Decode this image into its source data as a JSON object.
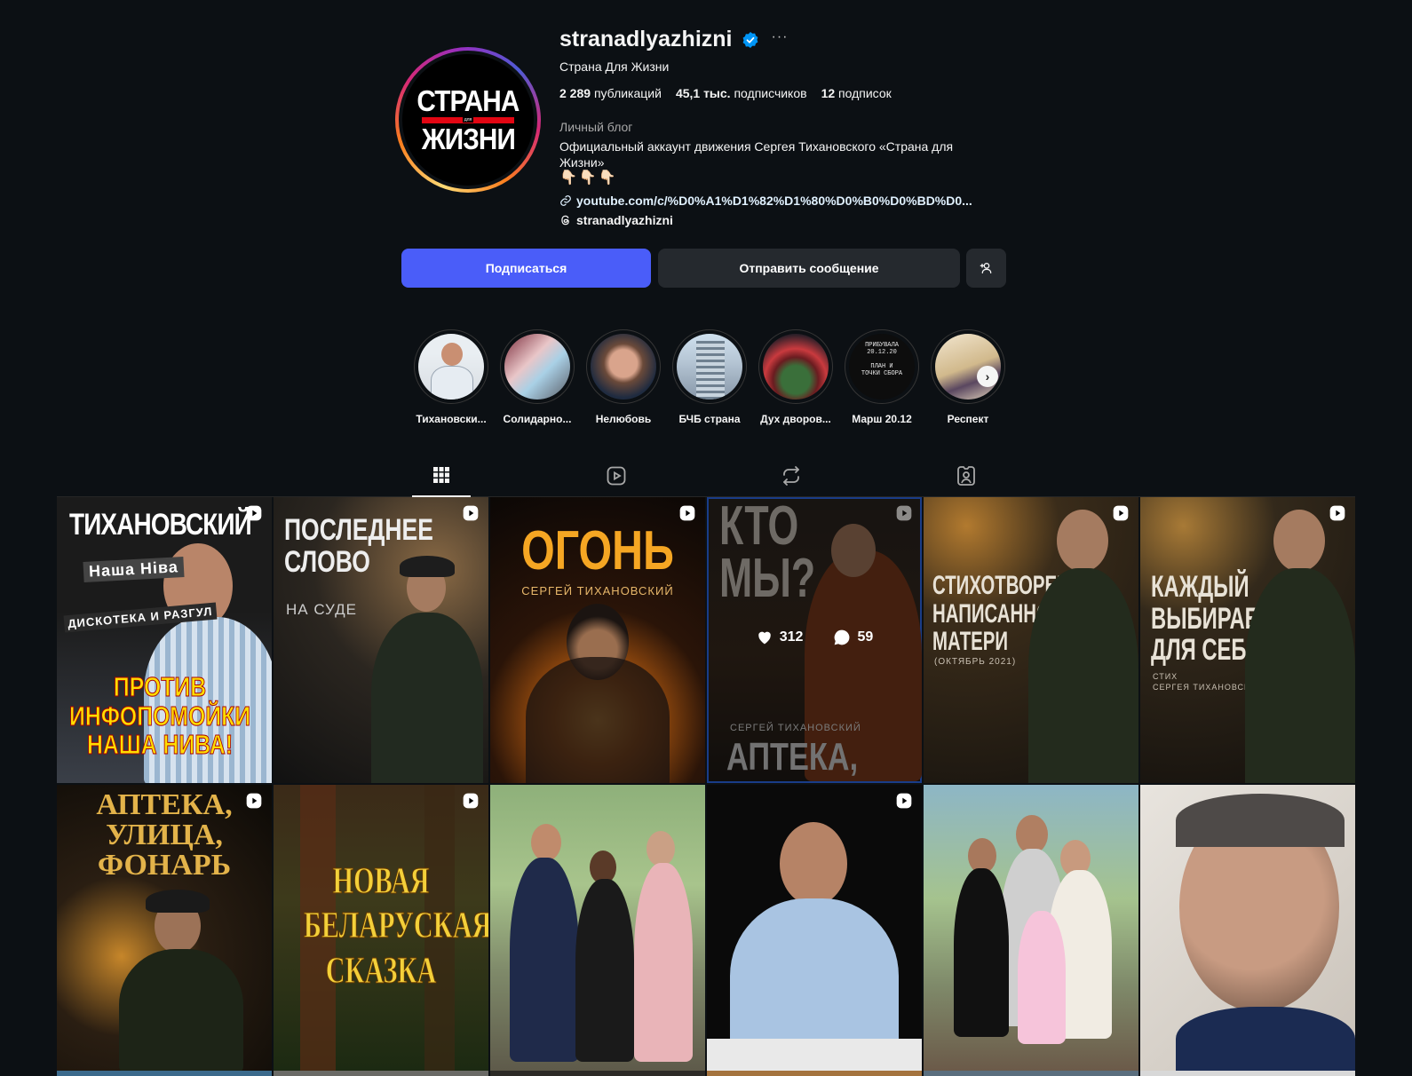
{
  "profile": {
    "username": "stranadlyazhizni",
    "full_name": "Страна Для Жизни",
    "avatar_text": {
      "line1": "СТРАНА",
      "line2": "для",
      "line3": "ЖИЗНИ"
    },
    "stats": {
      "posts_count": "2 289",
      "posts_label": "публикаций",
      "followers_count": "45,1 тыс.",
      "followers_label": "подписчиков",
      "following_count": "12",
      "following_label": "подписок"
    },
    "category": "Личный блог",
    "bio": "Официальный аккаунт движения Сергея Тихановского «Страна для Жизни»",
    "bio_emojis": "👇🏻👇🏻👇🏻",
    "link": "youtube.com/c/%D0%A1%D1%82%D1%80%D0%B0%D0%BD%D0...",
    "threads_handle": "stranadlyazhizni",
    "more_label": "···"
  },
  "actions": {
    "follow_label": "Подписаться",
    "message_label": "Отправить сообщение"
  },
  "highlights": [
    {
      "label": "Тихановски..."
    },
    {
      "label": "Солидарно..."
    },
    {
      "label": "Нелюбовь"
    },
    {
      "label": "БЧБ страна"
    },
    {
      "label": "Дух дворов..."
    },
    {
      "label": "Марш 20.12",
      "cover_text": "ПРИБУВАЛА\n20.12.20\n\nПЛАН И\nТОЧКИ СБОРА"
    },
    {
      "label": "Респект"
    }
  ],
  "posts": [
    {
      "title": "ТИХАНОВСКИЙ",
      "title2": "ПРОТИВ\nИНФОПОМОЙКИ\nНАША НИВА!",
      "sub": "Наша Ніва",
      "sub2": "ДИСКОТЕКА И РАЗГУЛ",
      "reel": true
    },
    {
      "title": "ПОСЛЕДНЕЕ\nСЛОВО",
      "sub": "НА СУДЕ",
      "reel": true
    },
    {
      "title": "ОГОНЬ",
      "sub": "СЕРГЕЙ ТИХАНОВСКИЙ",
      "reel": true
    },
    {
      "title": "КТО\nМЫ?",
      "sub": "СЕРГЕЙ ТИХАНОВСКИЙ",
      "title2": "АПТЕКА,",
      "reel": true,
      "likes": "312",
      "comments": "59"
    },
    {
      "title": "СТИХОТВОРЕНИЕ,\nНАПИСАННОЕ\nМАТЕРИ",
      "sub": "(ОКТЯБРЬ 2021)",
      "reel": true
    },
    {
      "title": "КАЖДЫЙ\nВЫБИРАЕТ\nДЛЯ СЕБЯ",
      "sub": "СТИХ\nСЕРГЕЯ ТИХАНОВСКОГО",
      "reel": true
    },
    {
      "title": "АПТЕКА,\nУЛИЦА,\nФОНАРЬ",
      "reel": true
    },
    {
      "title": "НОВАЯ\nБЕЛАРУСКАЯ\nСКАЗКА",
      "reel": true
    },
    {
      "reel": false
    },
    {
      "reel": true
    },
    {
      "reel": false
    },
    {
      "reel": false
    }
  ]
}
